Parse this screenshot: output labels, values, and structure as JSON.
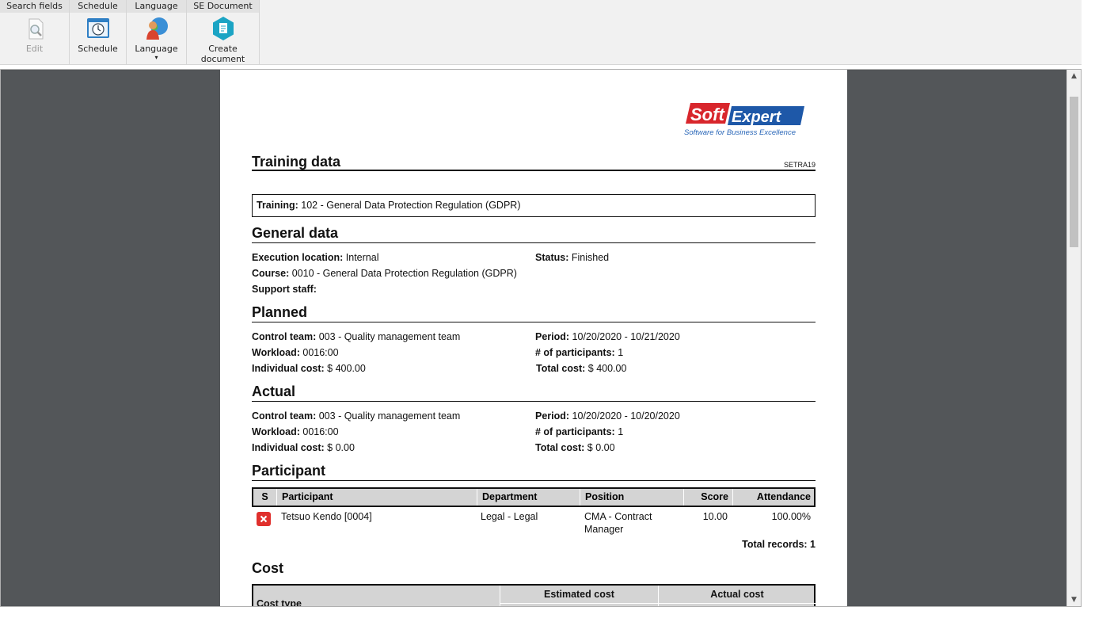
{
  "toolbar": {
    "groups": [
      {
        "header": "Search fields",
        "button": "Edit"
      },
      {
        "header": "Schedule",
        "button": "Schedule"
      },
      {
        "header": "Language",
        "button": "Language"
      },
      {
        "header": "SE Document",
        "button_line1": "Create",
        "button_line2": "document"
      }
    ]
  },
  "report": {
    "logo": {
      "brand_left": "Soft",
      "brand_right": "Expert",
      "tagline": "Software for Business Excellence"
    },
    "title": "Training data",
    "code": "SETRA19",
    "training": {
      "label": "Training:",
      "value": "102 - General Data Protection Regulation (GDPR)"
    },
    "general": {
      "heading": "General data",
      "execution_location": {
        "label": "Execution location:",
        "value": "Internal"
      },
      "status": {
        "label": "Status:",
        "value": "Finished"
      },
      "course": {
        "label": "Course:",
        "value": "0010 - General Data Protection Regulation (GDPR)"
      },
      "support_staff": {
        "label": "Support staff:",
        "value": ""
      }
    },
    "planned": {
      "heading": "Planned",
      "control_team": {
        "label": "Control team:",
        "value": "003 - Quality management team"
      },
      "period": {
        "label": "Period:",
        "value": "10/20/2020 - 10/21/2020"
      },
      "workload": {
        "label": "Workload:",
        "value": "0016:00"
      },
      "participants": {
        "label": "# of participants:",
        "value": "1"
      },
      "individual_cost": {
        "label": "Individual cost:",
        "value": "$ 400.00"
      },
      "total_cost": {
        "label": "Total cost:",
        "value": "$ 400.00"
      }
    },
    "actual": {
      "heading": "Actual",
      "control_team": {
        "label": "Control team:",
        "value": "003 - Quality management team"
      },
      "period": {
        "label": "Period:",
        "value": "10/20/2020 - 10/20/2020"
      },
      "workload": {
        "label": "Workload:",
        "value": "0016:00"
      },
      "participants": {
        "label": "# of participants:",
        "value": "1"
      },
      "individual_cost": {
        "label": "Individual cost:",
        "value": "$ 0.00"
      },
      "total_cost": {
        "label": "Total cost:",
        "value": "$ 0.00"
      }
    },
    "participant": {
      "heading": "Participant",
      "columns": [
        "S",
        "Participant",
        "Department",
        "Position",
        "Score",
        "Attendance"
      ],
      "rows": [
        {
          "participant": "Tetsuo Kendo [0004]",
          "department": "Legal - Legal",
          "position_line1": "CMA - Contract",
          "position_line2": "Manager",
          "score": "10.00",
          "attendance": "100.00%"
        }
      ],
      "total": "Total records: 1"
    },
    "cost": {
      "heading": "Cost",
      "col_cost_type": "Cost type",
      "col_estimated": "Estimated cost",
      "col_actual": "Actual cost"
    }
  }
}
